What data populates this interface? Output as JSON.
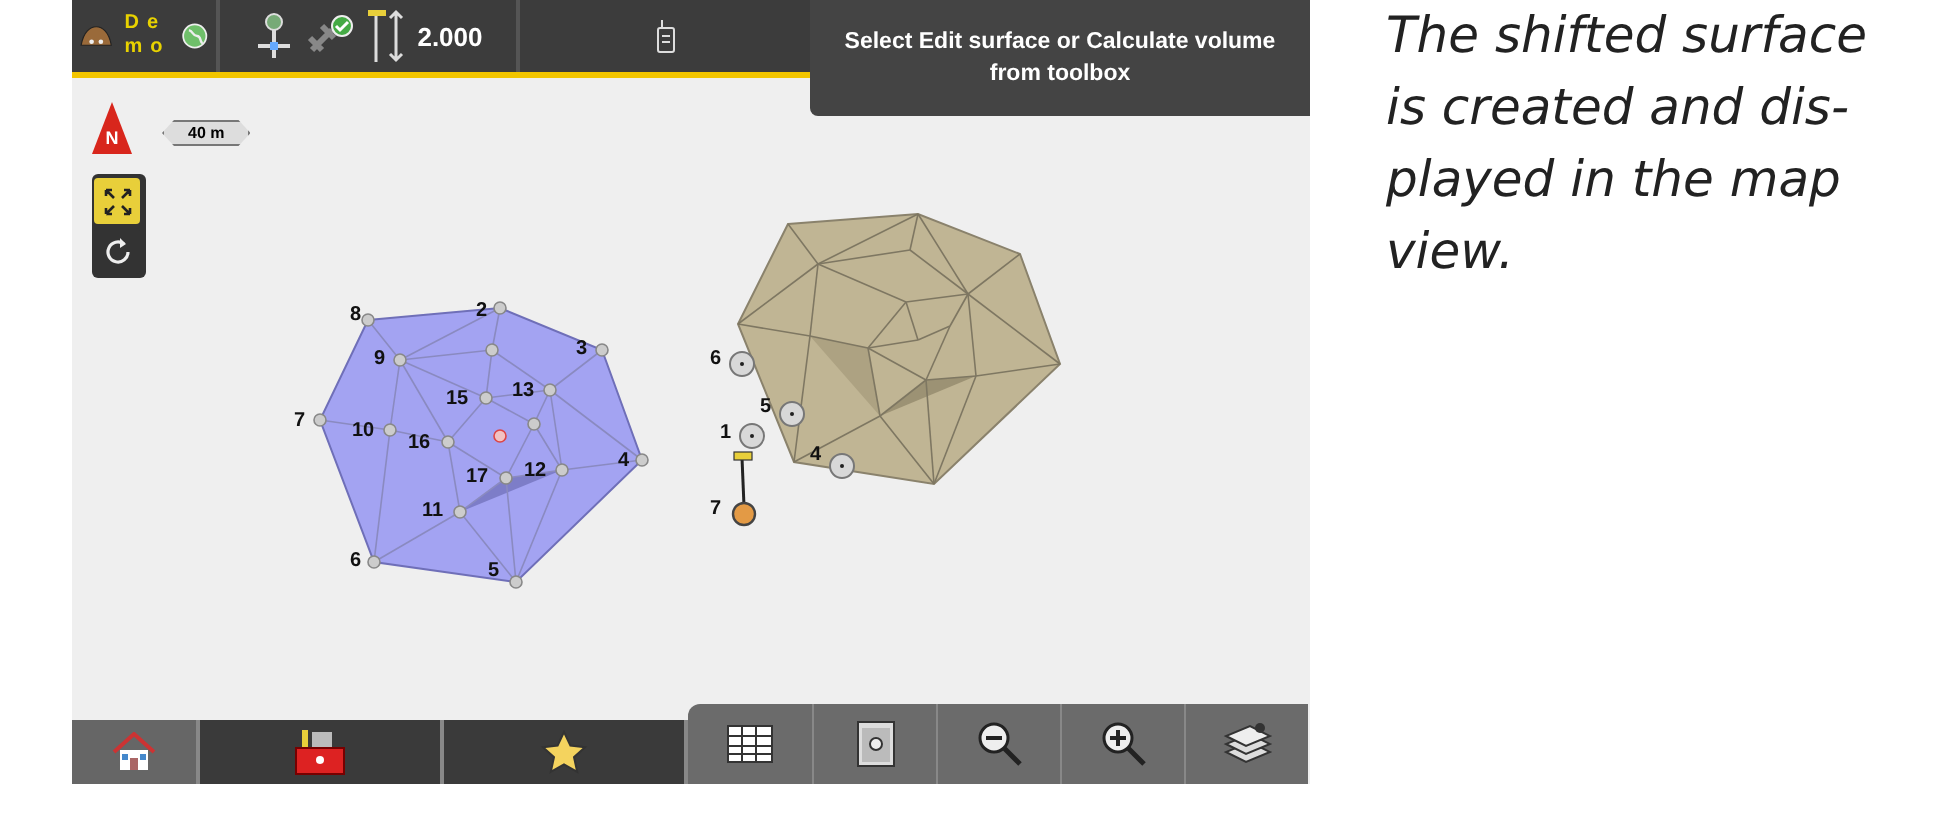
{
  "status_bar": {
    "logo_lines": [
      "De",
      "mo"
    ],
    "height_reading": "2.000"
  },
  "instruction": "Select Edit surface or Calculate volume from toolbox",
  "map": {
    "north_label": "N",
    "scale_bar": "40 m",
    "tools": [
      {
        "kind": "zoom-extents",
        "selected": true
      },
      {
        "kind": "rotate",
        "selected": false
      }
    ],
    "surfaces": [
      {
        "kind": "original",
        "points": [
          "8",
          "2",
          "3",
          "4",
          "5",
          "6",
          "7",
          "9",
          "10",
          "11",
          "12",
          "13",
          "15",
          "16",
          "17"
        ]
      },
      {
        "kind": "shifted",
        "points": [
          "6",
          "5",
          "1",
          "4",
          "7"
        ]
      }
    ]
  },
  "bottom_toolbar": [
    {
      "kind": "home"
    },
    {
      "kind": "toolbox"
    },
    {
      "kind": "favorites"
    }
  ],
  "view_toolbar": [
    {
      "kind": "table"
    },
    {
      "kind": "layout"
    },
    {
      "kind": "zoom-out"
    },
    {
      "kind": "zoom-in"
    },
    {
      "kind": "layers"
    }
  ],
  "caption_lines": [
    "The shifted surface",
    "is created and dis-",
    "played in the map",
    "view."
  ]
}
